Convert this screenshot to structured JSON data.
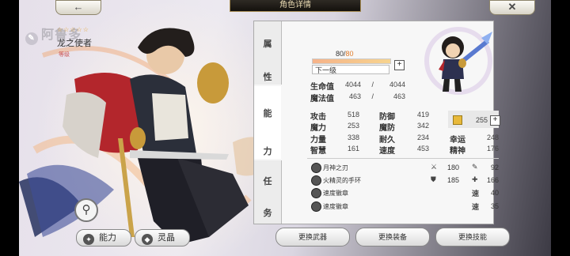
{
  "header": {
    "title": "角色详情",
    "back_icon": "←",
    "close_icon": "✕"
  },
  "hero": {
    "name": "阿鲁多",
    "name_icon": "✎"
  },
  "actions": {
    "ability_label": "能力",
    "spirit_label": "灵晶"
  },
  "tabs": [
    {
      "label_1": "属",
      "label_2": "性"
    },
    {
      "label_1": "能",
      "label_2": "力"
    },
    {
      "label_1": "任",
      "label_2": "务"
    }
  ],
  "character": {
    "stars": "☆☆☆☆☆",
    "title": "龙之使者",
    "level_label": "等级",
    "level": "80",
    "level_sep": "/",
    "level_max": "80",
    "level_progress": 1.0,
    "next_level": "下一级"
  },
  "vitals": [
    {
      "label": "生命值",
      "cur": "4044",
      "sep": "/",
      "max": "4044"
    },
    {
      "label": "魔法值",
      "cur": "463",
      "sep": "/",
      "max": "463"
    }
  ],
  "stats": [
    {
      "label": "攻击",
      "value": "518"
    },
    {
      "label": "防御",
      "value": "419"
    },
    {
      "label": "魔力",
      "value": "253"
    },
    {
      "label": "魔防",
      "value": "342"
    },
    {
      "label": "力量",
      "value": "338"
    },
    {
      "label": "耐久",
      "value": "234"
    },
    {
      "label": "幸运",
      "value": "248"
    },
    {
      "label": "智慧",
      "value": "161"
    },
    {
      "label": "速度",
      "value": "453"
    },
    {
      "label": "精神",
      "value": "176"
    }
  ],
  "spirit_crystal": {
    "value": "255",
    "plus": "+"
  },
  "equipment": [
    {
      "name": "月神之刃",
      "stat1_icon": "⚔",
      "stat1": "180",
      "stat2_icon": "✎",
      "stat2": "92"
    },
    {
      "name": "火精灵的手环",
      "stat1_icon": "⛊",
      "stat1": "185",
      "stat2_icon": "✚",
      "stat2": "166"
    },
    {
      "name": "速度徽章",
      "stat_label": "速",
      "stat": "40"
    },
    {
      "name": "速度徽章",
      "stat_label": "速",
      "stat": "35"
    }
  ],
  "buttons": {
    "change_weapon": "更换武器",
    "change_equipment": "更换装备",
    "change_skill": "更换技能"
  },
  "icons": {
    "zoom": "search-icon",
    "plus": "+"
  }
}
